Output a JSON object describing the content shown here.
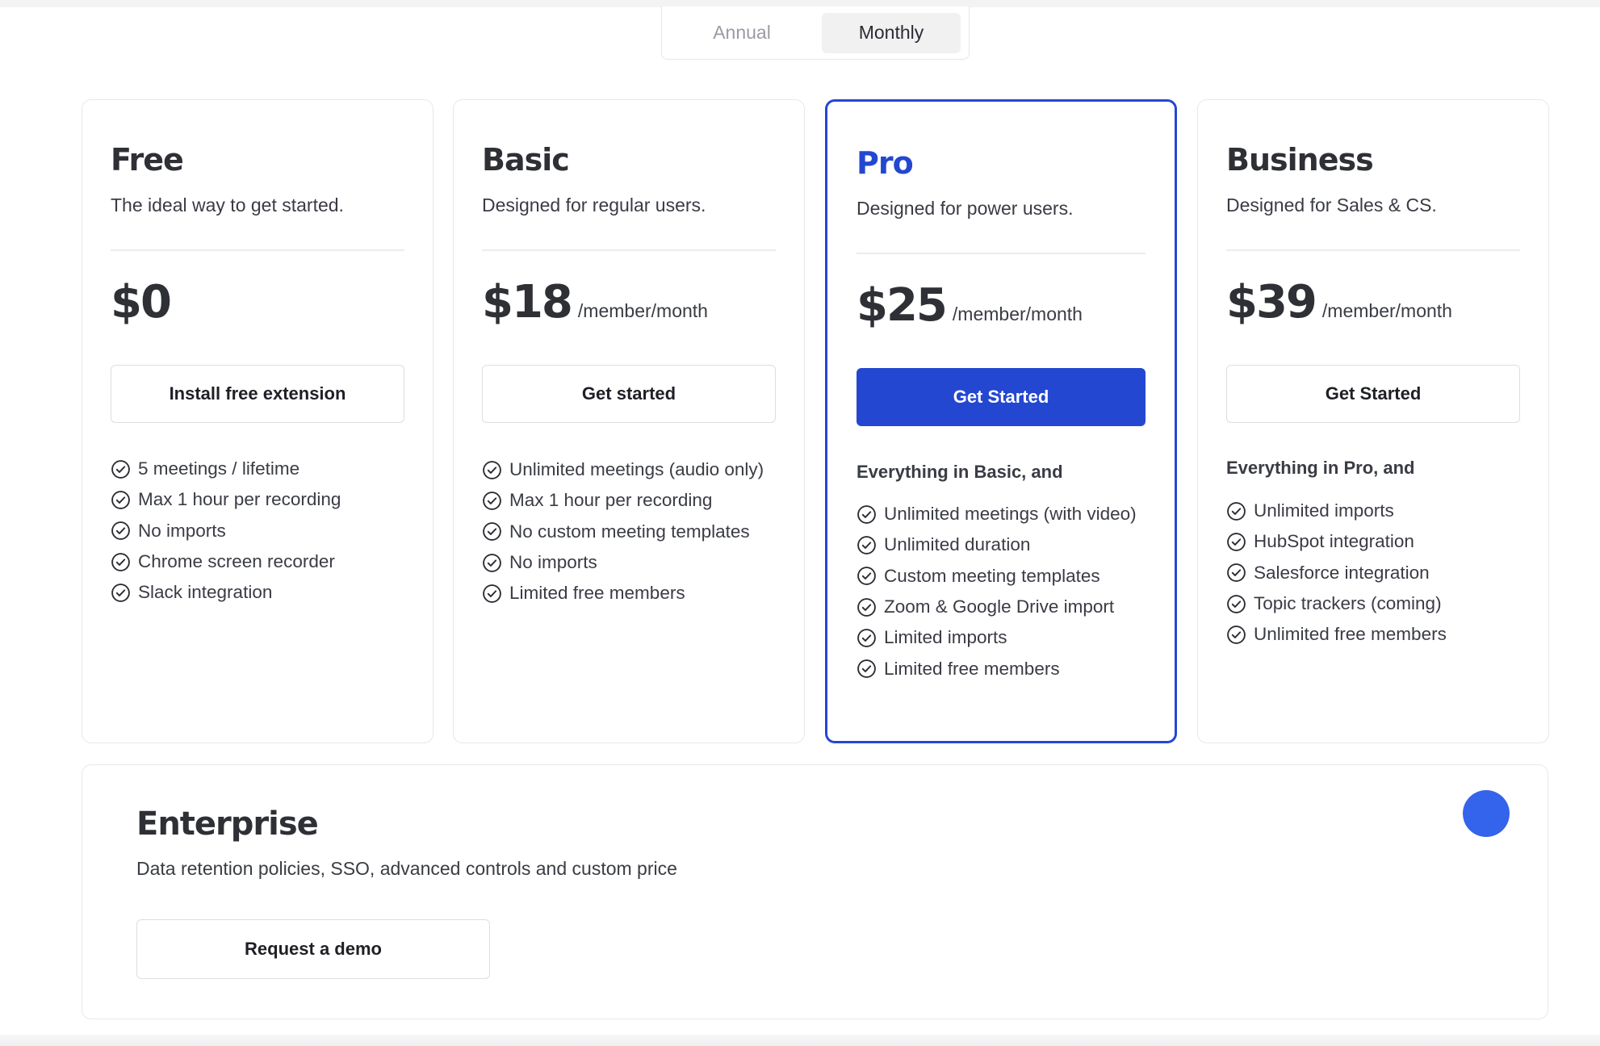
{
  "billing_toggle": {
    "annual_label": "Annual",
    "monthly_label": "Monthly",
    "selected": "Monthly"
  },
  "plans": [
    {
      "name": "Free",
      "description": "The ideal way to get started.",
      "price": "$0",
      "price_unit": "",
      "button_label": "Install free extension",
      "lead": "",
      "features": [
        "5 meetings / lifetime",
        "Max 1 hour per recording",
        "No imports",
        "Chrome screen recorder",
        "Slack integration"
      ]
    },
    {
      "name": "Basic",
      "description": "Designed for regular users.",
      "price": "$18",
      "price_unit": "/member/month",
      "button_label": "Get started",
      "lead": "",
      "features": [
        "Unlimited meetings (audio only)",
        "Max 1 hour per recording",
        "No custom meeting templates",
        "No imports",
        "Limited free members"
      ]
    },
    {
      "name": "Pro",
      "description": "Designed for power users.",
      "price": "$25",
      "price_unit": "/member/month",
      "button_label": "Get Started",
      "lead": "Everything in Basic, and",
      "features": [
        "Unlimited meetings (with video)",
        "Unlimited duration",
        "Custom meeting templates",
        "Zoom & Google Drive import",
        "Limited imports",
        "Limited free members"
      ]
    },
    {
      "name": "Business",
      "description": "Designed for Sales & CS.",
      "price": "$39",
      "price_unit": "/member/month",
      "button_label": "Get Started",
      "lead": "Everything in Pro, and",
      "features": [
        "Unlimited imports",
        "HubSpot integration",
        "Salesforce integration",
        "Topic trackers (coming)",
        "Unlimited free members"
      ]
    }
  ],
  "enterprise": {
    "title": "Enterprise",
    "description": "Data retention policies, SSO, advanced controls and custom price",
    "button_label": "Request a demo"
  },
  "colors": {
    "accent": "#2447d1",
    "chat_bubble": "#3463ec",
    "text": "#2e3036"
  },
  "icons": {
    "feature": "check-circle-icon",
    "chat": "chat-bubble-icon"
  }
}
